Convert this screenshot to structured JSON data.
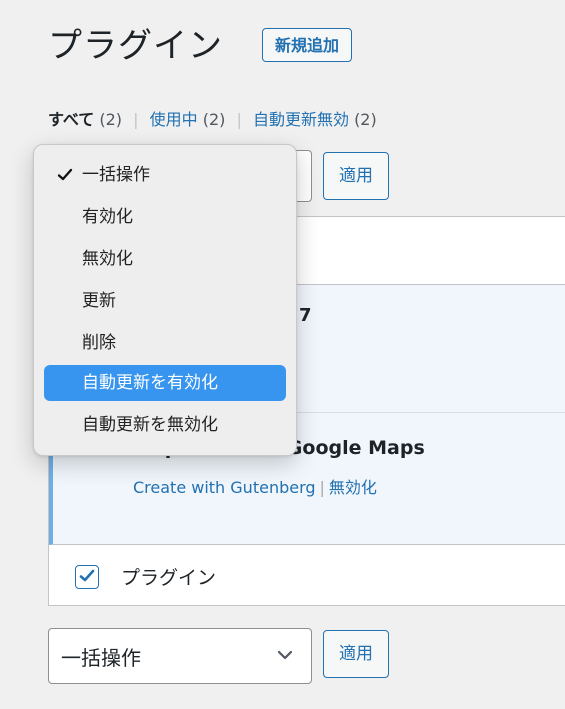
{
  "header": {
    "title": "プラグイン",
    "add_new_label": "新規追加"
  },
  "filters": {
    "all_label": "すべて",
    "all_count": "(2)",
    "active_label": "使用中",
    "active_count": "(2)",
    "auto_updates_disabled_label": "自動更新無効",
    "auto_updates_disabled_count": "(2)"
  },
  "bulk_actions_top": {
    "apply_label": "適用"
  },
  "dropdown": {
    "selected_index": 0,
    "highlighted_index": 5,
    "options": [
      "一括操作",
      "有効化",
      "無効化",
      "更新",
      "削除",
      "自動更新を有効化",
      "自動更新を無効化"
    ]
  },
  "table": {
    "row1_title_fragment": "7",
    "row2": {
      "name": "Map Block for Google Maps",
      "actions": [
        "Create with Gutenberg",
        "無効化"
      ]
    },
    "footer_label": "プラグイン"
  },
  "bulk_actions_bottom": {
    "selected_label": "一括操作",
    "apply_label": "適用"
  },
  "colors": {
    "background": "#f0f0f1",
    "accent": "#2271b1",
    "row_highlight": "#f0f6fc",
    "row_accent": "#72aee6",
    "menu_highlight": "#3795ef"
  },
  "icons": {
    "menu_check": "check-icon",
    "select_arrow": "chevron-down-icon",
    "footer_checkbox": "checkbox-checked-icon"
  }
}
